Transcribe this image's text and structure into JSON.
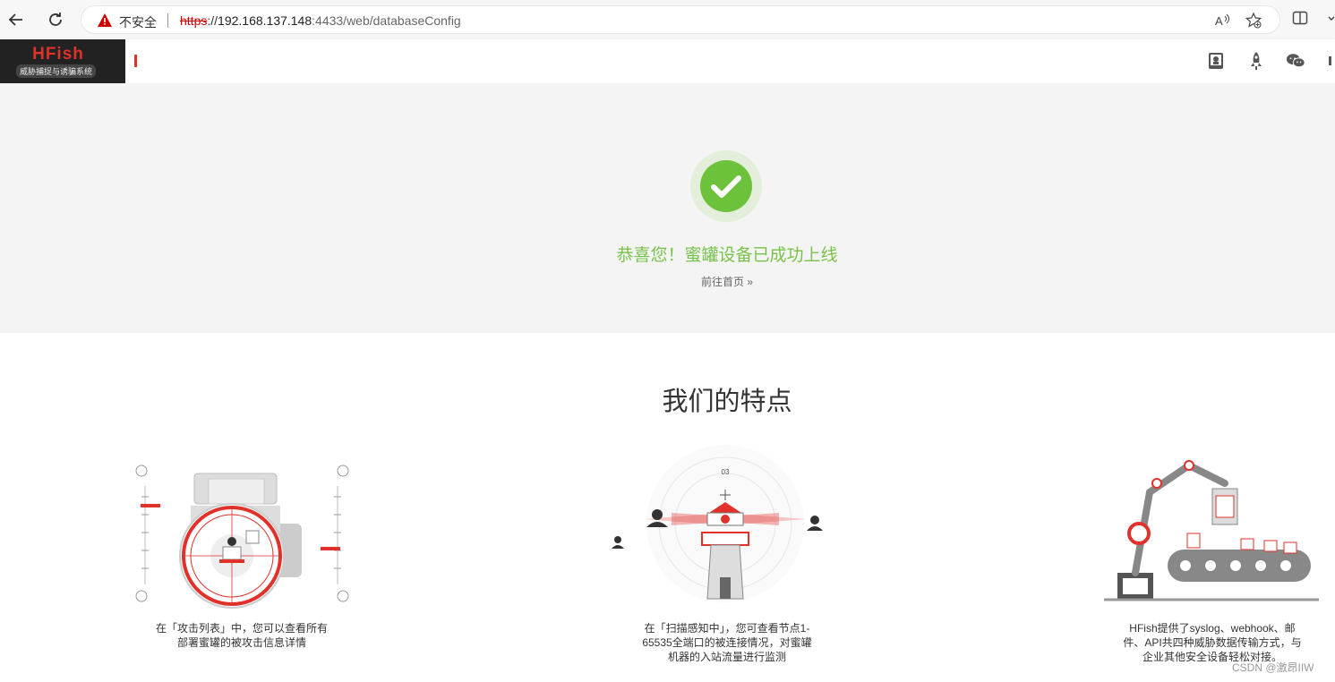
{
  "browser": {
    "security_label": "不安全",
    "url_scheme": "https",
    "url_sep": "://",
    "url_host": "192.168.137.148",
    "url_path": ":4433/web/databaseConfig"
  },
  "app": {
    "logo_title": "HFish",
    "logo_subtitle": "威胁捕捉与诱骗系统"
  },
  "success": {
    "title": "恭喜您！蜜罐设备已成功上线",
    "home_link": "前往首页 »"
  },
  "features": {
    "title": "我们的特点",
    "items": [
      {
        "text1": "在「攻击列表」中，您可以查看所有",
        "text2": "部署蜜罐的被攻击信息详情",
        "text3": ""
      },
      {
        "text1": "在「扫描感知中」，您可查看节点1-",
        "text2": "65535全端口的被连接情况，对蜜罐",
        "text3": "机器的入站流量进行监测"
      },
      {
        "text1": "HFish提供了syslog、webhook、邮",
        "text2": "件、API共四种威胁数据传输方式，与",
        "text3": "企业其他安全设备轻松对接。"
      }
    ]
  },
  "watermark": "CSDN @激昂IIW",
  "colors": {
    "brand_red": "#e0322b",
    "success_green": "#6cc23a",
    "success_text": "#79c24a"
  }
}
